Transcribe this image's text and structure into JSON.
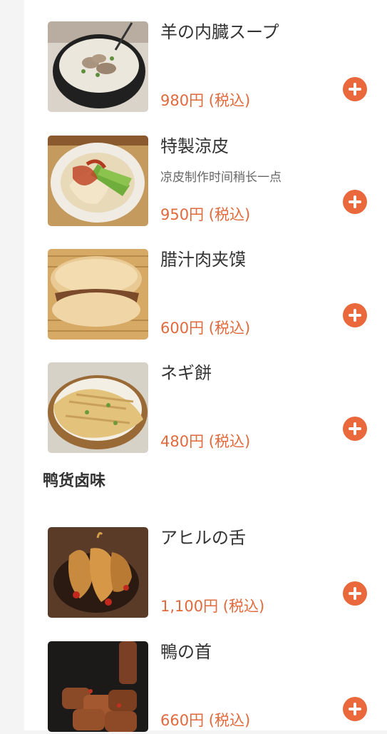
{
  "accent_color": "#e9693c",
  "items_top": [
    {
      "name": "羊の内臓スープ",
      "desc": "",
      "price": "980円 (税込)",
      "image": "offal-soup-photo"
    },
    {
      "name": "特製涼皮",
      "desc": "凉皮制作时间稍长一点",
      "price": "950円 (税込)",
      "image": "liangpi-noodles-photo"
    },
    {
      "name": "腊汁肉夹馍",
      "desc": "",
      "price": "600円 (税込)",
      "image": "roujiamo-bun-photo"
    },
    {
      "name": "ネギ餅",
      "desc": "",
      "price": "480円 (税込)",
      "image": "scallion-pancake-photo"
    }
  ],
  "section": {
    "title": "鸭货卤味"
  },
  "items_bottom": [
    {
      "name": "アヒルの舌",
      "desc": "",
      "price": "1,100円 (税込)",
      "image": "duck-tongue-photo"
    },
    {
      "name": "鴨の首",
      "desc": "",
      "price": "660円 (税込)",
      "image": "duck-neck-photo"
    }
  ],
  "icons": {
    "add": "plus-circle-icon"
  }
}
